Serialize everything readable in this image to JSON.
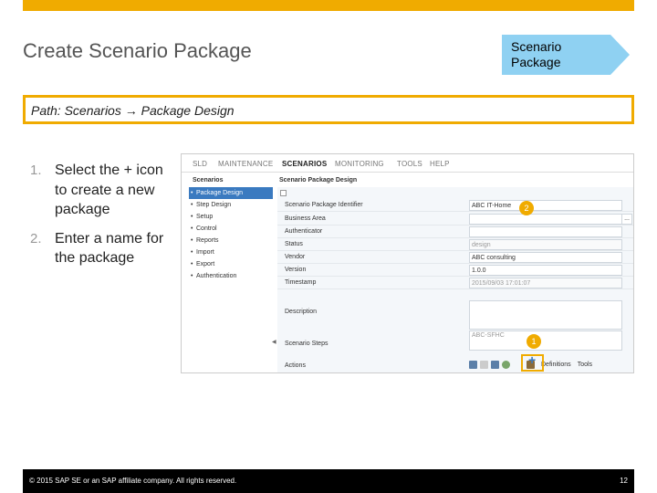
{
  "slide": {
    "title": "Create Scenario Package",
    "chevron": "Scenario Package",
    "path": "Path: Scenarios → Package Design",
    "steps": [
      {
        "num": "1.",
        "text": "Select the + icon to create a new package"
      },
      {
        "num": "2.",
        "text": "Enter a name for the package"
      }
    ]
  },
  "app": {
    "nav": [
      "SLD",
      "MAINTENANCE",
      "SCENARIOS",
      "MONITORING",
      "TOOLS",
      "HELP"
    ],
    "active_nav": "SCENARIOS",
    "sidebar": {
      "title": "Scenarios",
      "items": [
        "Package Design",
        "Step Design",
        "Setup",
        "Control",
        "Reports",
        "Import",
        "Export",
        "Authentication"
      ]
    },
    "main": {
      "title": "Scenario Package Design",
      "fields": [
        {
          "label": "Scenario Package Identifier",
          "value": "ABC IT-Home"
        },
        {
          "label": "Business Area",
          "value": ""
        },
        {
          "label": "Authenticator",
          "value": ""
        },
        {
          "label": "Status",
          "value": "design"
        },
        {
          "label": "Vendor",
          "value": "ABC consulting"
        },
        {
          "label": "Version",
          "value": "1.0.0"
        },
        {
          "label": "Timestamp",
          "value": "2015/09/03 17:01:07"
        }
      ],
      "description_label": "Description",
      "steps_label": "Scenario Steps",
      "steps_value": "ABC-SFHC",
      "actions_label": "Actions",
      "actions": [
        "Definitions",
        "Tools"
      ],
      "browse_suffix": "..."
    },
    "badge_1": "1",
    "badge_2": "2",
    "plus_symbol": "+"
  },
  "footer": {
    "copyright": "© 2015 SAP SE or an SAP affiliate company. All rights reserved.",
    "page": "12"
  },
  "colors": {
    "accent": "#f0ab00",
    "chevron": "#8fd1f2",
    "selection": "#3a7ac0"
  }
}
